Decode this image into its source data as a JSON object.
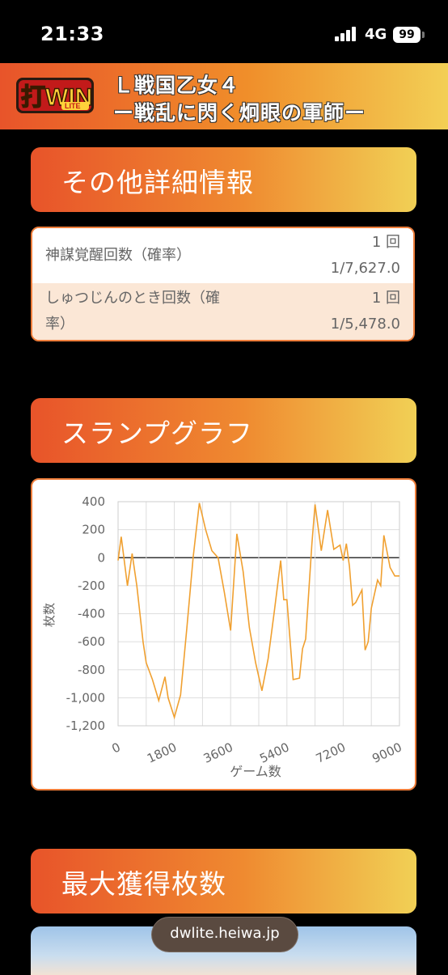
{
  "status_bar": {
    "time": "21:33",
    "network": "4G",
    "battery": "99"
  },
  "header": {
    "logo_text": "打WIN",
    "logo_sub": "LITE",
    "title_line1": "Ｌ戦国乙女４",
    "title_line2": "ー戦乱に閃く炯眼の軍師ー"
  },
  "sections": {
    "other_info": "その他詳細情報",
    "slump_graph": "スランプグラフ",
    "max_medals": "最大獲得枚数"
  },
  "info_rows": [
    {
      "label": "神謀覚醒回数（確率）",
      "count": "1 回",
      "prob": "1/7,627.0"
    },
    {
      "label_line1": "しゅつじんのとき回数（確",
      "label_line2": "率）",
      "count": "1 回",
      "prob": "1/5,478.0"
    }
  ],
  "chart_data": {
    "type": "line",
    "title": "",
    "xlabel": "ゲーム数",
    "ylabel": "枚数",
    "xlim": [
      0,
      9000
    ],
    "ylim": [
      -1200,
      400
    ],
    "x_ticks": [
      "0",
      "1800",
      "3600",
      "5400",
      "7200",
      "9000"
    ],
    "y_ticks": [
      "400",
      "200",
      "0",
      "-200",
      "-400",
      "-600",
      "-800",
      "-1,000",
      "-1,200"
    ],
    "grid": true,
    "line_color": "#f0a030",
    "series": [
      {
        "x": [
          0,
          100,
          300,
          450,
          600,
          800,
          900,
          1100,
          1300,
          1500,
          1600,
          1800,
          2000,
          2200,
          2400,
          2600,
          2800,
          3000,
          3200,
          3400,
          3600,
          3800,
          4000,
          4200,
          4400,
          4600,
          4800,
          5000,
          5200,
          5300,
          5400,
          5600,
          5800,
          5900,
          6000,
          6200,
          6300,
          6500,
          6700,
          6900,
          7100,
          7200,
          7300,
          7400,
          7500,
          7600,
          7800,
          7900,
          8000,
          8100,
          8300,
          8400,
          8500,
          8700,
          8850,
          9000
        ],
        "y": [
          -20,
          150,
          -200,
          30,
          -200,
          -600,
          -750,
          -870,
          -1020,
          -850,
          -1000,
          -1140,
          -980,
          -500,
          0,
          390,
          200,
          50,
          0,
          -250,
          -520,
          170,
          -100,
          -500,
          -750,
          -950,
          -720,
          -380,
          -20,
          -300,
          -300,
          -870,
          -860,
          -650,
          -580,
          100,
          380,
          50,
          340,
          60,
          90,
          -20,
          100,
          -60,
          -340,
          -320,
          -230,
          -660,
          -600,
          -360,
          -160,
          -200,
          160,
          -70,
          -130,
          -130
        ]
      }
    ]
  },
  "footer": {
    "url": "dwlite.heiwa.jp"
  },
  "colors": {
    "accent_orange": "#e8542a",
    "accent_yellow": "#f3cf55",
    "border": "#ee7d3a",
    "row_alt": "#fbe7d6"
  }
}
